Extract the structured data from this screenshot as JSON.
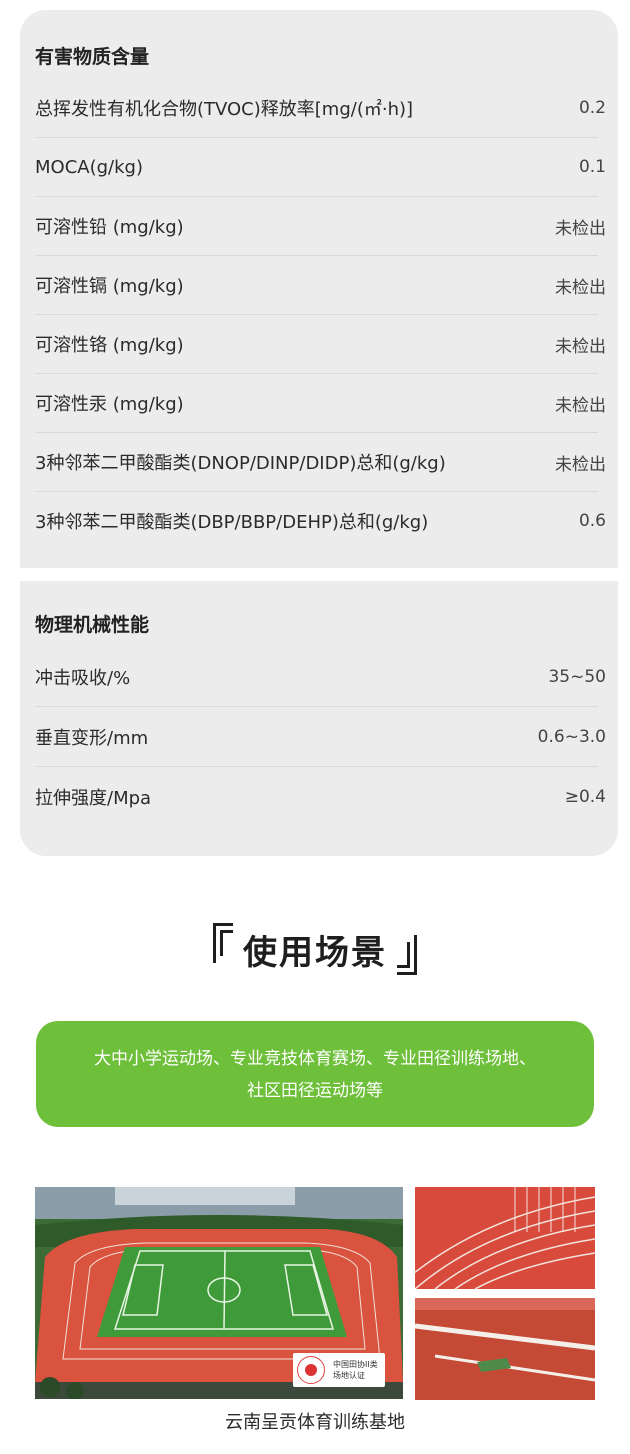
{
  "harmful": {
    "title": "有害物质含量",
    "rows": [
      {
        "label": "总挥发性有机化合物(TVOC)释放率[mg/(㎡·h)]",
        "value": "0.2"
      },
      {
        "label": "MOCA(g/kg)",
        "value": "0.1"
      },
      {
        "label": "可溶性铅 (mg/kg)",
        "value": "未检出"
      },
      {
        "label": "可溶性镉 (mg/kg)",
        "value": "未检出"
      },
      {
        "label": "可溶性铬 (mg/kg)",
        "value": "未检出"
      },
      {
        "label": "可溶性汞 (mg/kg)",
        "value": "未检出"
      },
      {
        "label": "3种邻苯二甲酸酯类(DNOP/DINP/DIDP)总和(g/kg)",
        "value": "未检出"
      },
      {
        "label": "3种邻苯二甲酸酯类(DBP/BBP/DEHP)总和(g/kg)",
        "value": "0.6"
      }
    ]
  },
  "physical": {
    "title": "物理机械性能",
    "rows": [
      {
        "label": "冲击吸收/%",
        "value": "35~50"
      },
      {
        "label": "垂直变形/mm",
        "value": "0.6~3.0"
      },
      {
        "label": "拉伸强度/Mpa",
        "value": "≥0.4"
      }
    ]
  },
  "usage": {
    "title": "使用场景",
    "line1": "大中小学运动场、专业竞技体育赛场、专业田径训练场地、",
    "line2": "社区田径运动场等"
  },
  "photos": {
    "badge_line1": "中国田协II类",
    "badge_line2": "场地认证",
    "caption": "云南呈贡体育训练基地"
  },
  "colors": {
    "card_bg": "#ececec",
    "accent_green": "#6ebf3a",
    "track_red": "#d84a3c"
  }
}
